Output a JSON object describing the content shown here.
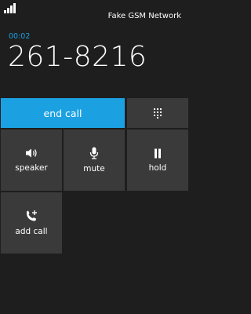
{
  "status_bar": {
    "network": "Fake GSM Network",
    "signal_icon": "signal-bars-icon"
  },
  "call": {
    "timer": "00:02",
    "number": "261-8216"
  },
  "controls": {
    "end_call": "end call",
    "keypad_icon": "keypad-icon",
    "speaker": {
      "label": "speaker",
      "icon": "speaker-icon"
    },
    "mute": {
      "label": "mute",
      "icon": "microphone-icon"
    },
    "hold": {
      "label": "hold",
      "icon": "pause-icon"
    },
    "add_call": {
      "label": "add call",
      "icon": "add-call-icon"
    }
  },
  "colors": {
    "accent": "#1ba1e2",
    "tile": "#3a3a3a",
    "background": "#1e1e1e"
  }
}
